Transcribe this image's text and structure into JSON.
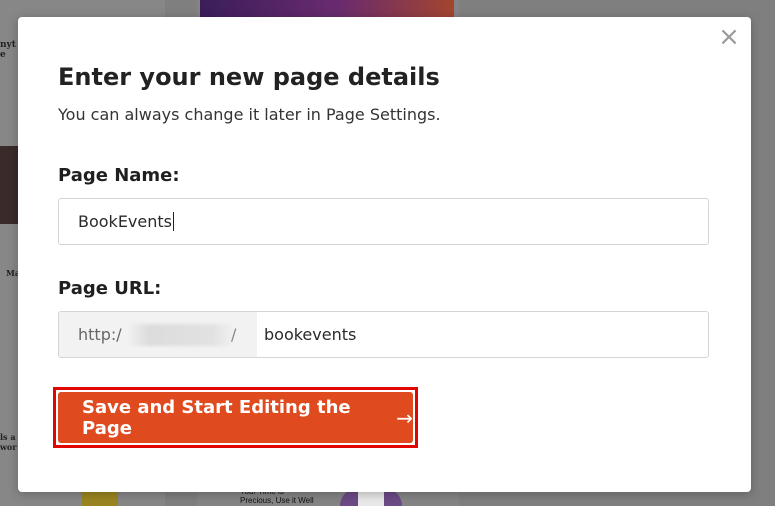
{
  "background": {
    "left_text": "nyt\ne",
    "left_text_mid": "Ma",
    "left_text_low": "ls a\nwor",
    "footer_text": "Your Time is\nPrecious, Use it Well"
  },
  "modal": {
    "close_glyph": "×",
    "title": "Enter your new page details",
    "subtitle": "You can always change it later in Page Settings.",
    "page_name_label": "Page Name:",
    "page_name_value": "BookEvents",
    "page_url_label": "Page URL:",
    "url_prefix": "http:/",
    "url_slash": "/",
    "url_slug": "bookevents",
    "cta_label": "Save and Start Editing the Page",
    "cta_arrow": "→"
  },
  "colors": {
    "cta": "#e04a1f",
    "highlight_outline": "#e10600"
  }
}
